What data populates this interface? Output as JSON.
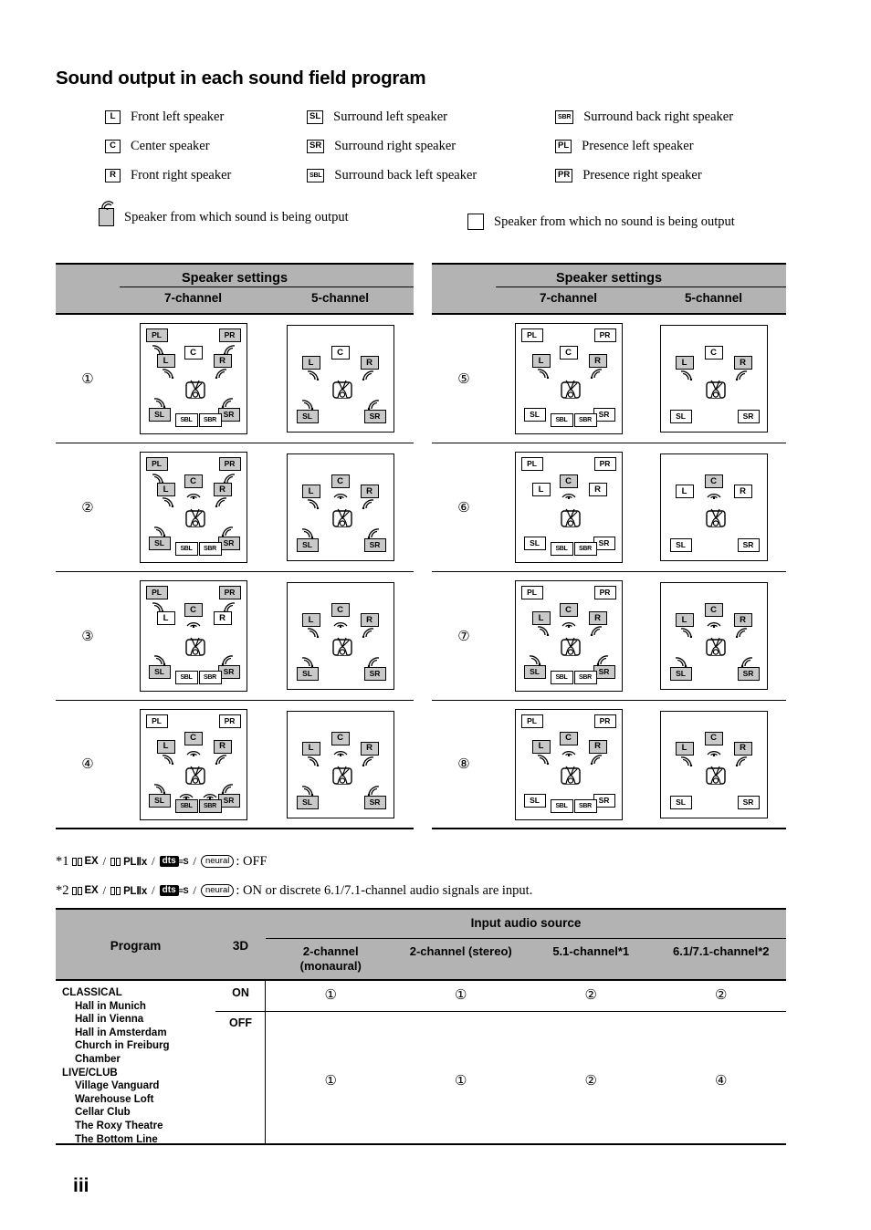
{
  "page": {
    "title": "Sound output in each sound field program",
    "folio": "iii"
  },
  "legend": {
    "speakers": [
      {
        "code": "L",
        "label": "Front left speaker"
      },
      {
        "code": "SL",
        "label": "Surround left speaker"
      },
      {
        "code": "SBR",
        "label": "Surround back right speaker"
      },
      {
        "code": "C",
        "label": "Center speaker"
      },
      {
        "code": "SR",
        "label": "Surround right speaker"
      },
      {
        "code": "PL",
        "label": "Presence left speaker"
      },
      {
        "code": "R",
        "label": "Front right speaker"
      },
      {
        "code": "SBL",
        "label": "Surround back left speaker"
      },
      {
        "code": "PR",
        "label": "Presence right speaker"
      }
    ],
    "state_on": "Speaker from which sound is being output",
    "state_off": "Speaker from which no sound is being output"
  },
  "diagram_tables": {
    "header": {
      "group": "Speaker settings",
      "col_7ch": "7-channel",
      "col_5ch": "5-channel"
    },
    "left_rows": [
      {
        "num": "①",
        "seven": {
          "PL": true,
          "PR": true,
          "L": true,
          "C": false,
          "R": true,
          "SL": true,
          "SBL": false,
          "SBR": false,
          "SR": true
        },
        "five": {
          "L": true,
          "C": false,
          "R": true,
          "SL": true,
          "SR": true
        }
      },
      {
        "num": "②",
        "seven": {
          "PL": true,
          "PR": true,
          "L": true,
          "C": true,
          "R": true,
          "SL": true,
          "SBL": false,
          "SBR": false,
          "SR": true
        },
        "five": {
          "L": true,
          "C": true,
          "R": true,
          "SL": true,
          "SR": true
        }
      },
      {
        "num": "③",
        "seven": {
          "PL": true,
          "PR": true,
          "L": false,
          "C": true,
          "R": false,
          "SL": true,
          "SBL": false,
          "SBR": false,
          "SR": true
        },
        "five": {
          "L": true,
          "C": true,
          "R": true,
          "SL": true,
          "SR": true
        }
      },
      {
        "num": "④",
        "seven": {
          "PL": false,
          "PR": false,
          "L": true,
          "C": true,
          "R": true,
          "SL": true,
          "SBL": true,
          "SBR": true,
          "SR": true
        },
        "five": {
          "L": true,
          "C": true,
          "R": true,
          "SL": true,
          "SR": true
        }
      }
    ],
    "right_rows": [
      {
        "num": "⑤",
        "seven": {
          "PL": false,
          "PR": false,
          "L": true,
          "C": false,
          "R": true,
          "SL": false,
          "SBL": false,
          "SBR": false,
          "SR": false
        },
        "five": {
          "L": true,
          "C": false,
          "R": true,
          "SL": false,
          "SR": false
        }
      },
      {
        "num": "⑥",
        "seven": {
          "PL": false,
          "PR": false,
          "L": false,
          "C": true,
          "R": false,
          "SL": false,
          "SBL": false,
          "SBR": false,
          "SR": false
        },
        "five": {
          "L": false,
          "C": true,
          "R": false,
          "SL": false,
          "SR": false
        }
      },
      {
        "num": "⑦",
        "seven": {
          "PL": false,
          "PR": false,
          "L": true,
          "C": true,
          "R": true,
          "SL": true,
          "SBL": false,
          "SBR": false,
          "SR": true
        },
        "five": {
          "L": true,
          "C": true,
          "R": true,
          "SL": true,
          "SR": true
        }
      },
      {
        "num": "⑧",
        "seven": {
          "PL": false,
          "PR": false,
          "L": true,
          "C": true,
          "R": true,
          "SL": false,
          "SBL": false,
          "SBR": false,
          "SR": false
        },
        "five": {
          "L": true,
          "C": true,
          "R": true,
          "SL": false,
          "SR": false
        }
      }
    ],
    "speaker_codes": {
      "PL": "PL",
      "PR": "PR",
      "L": "L",
      "C": "C",
      "R": "R",
      "SL": "SL",
      "SR": "SR",
      "SBL": "SBL",
      "SBR": "SBR"
    }
  },
  "footnotes": [
    {
      "marker": "*1",
      "logo_ex": "EX",
      "logo_plx": "PLⅡx",
      "logo_dts": "dts",
      "logo_es": "≡S",
      "logo_neural": "neural",
      "text": ": OFF"
    },
    {
      "marker": "*2",
      "logo_ex": "EX",
      "logo_plx": "PLⅡx",
      "logo_dts": "dts",
      "logo_es": "≡S",
      "logo_neural": "neural",
      "text": ": ON or discrete 6.1/7.1-channel audio signals are input."
    }
  ],
  "program_table": {
    "headers": {
      "program": "Program",
      "three_d": "3D",
      "input_audio_source": "Input audio source",
      "cols": [
        "2-channel\n(monaural)",
        "2-channel (stereo)",
        "5.1-channel*1",
        "6.1/7.1-channel*2"
      ],
      "col_2ch_mono_line1": "2-channel",
      "col_2ch_mono_line2": "(monaural)",
      "col_2ch_stereo": "2-channel (stereo)",
      "col_51": "5.1-channel*1",
      "col_6171": "6.1/7.1-channel*2"
    },
    "programs": [
      {
        "type": "group",
        "label": "CLASSICAL"
      },
      {
        "type": "item",
        "label": "Hall in Munich"
      },
      {
        "type": "item",
        "label": "Hall in Vienna"
      },
      {
        "type": "item",
        "label": "Hall in Amsterdam"
      },
      {
        "type": "item",
        "label": "Church in Freiburg"
      },
      {
        "type": "item",
        "label": "Chamber"
      },
      {
        "type": "group",
        "label": "LIVE/CLUB"
      },
      {
        "type": "item",
        "label": "Village Vanguard"
      },
      {
        "type": "item",
        "label": "Warehouse Loft"
      },
      {
        "type": "item",
        "label": "Cellar Club"
      },
      {
        "type": "item",
        "label": "The Roxy Theatre"
      },
      {
        "type": "item",
        "label": "The Bottom Line"
      }
    ],
    "three_d_on": "ON",
    "three_d_off": "OFF",
    "row_on": [
      "①",
      "①",
      "②",
      "②"
    ],
    "row_off": [
      "①",
      "①",
      "②",
      "④"
    ]
  },
  "colors": {
    "header_gray": "#b3b3b3",
    "speaker_on": "#c9c9c9",
    "speaker_off": "#ffffff",
    "rule": "#000000"
  }
}
